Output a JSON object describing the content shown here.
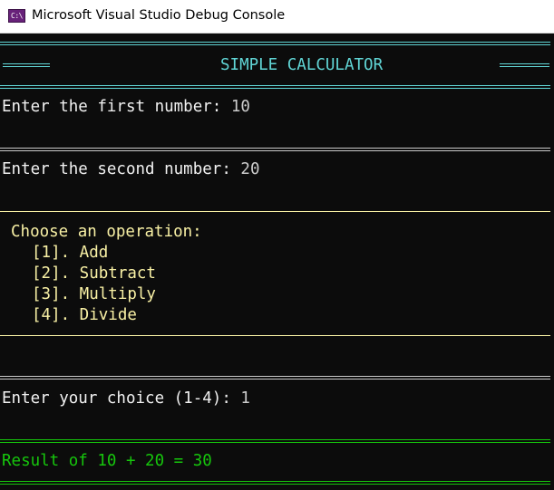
{
  "window": {
    "title": "Microsoft Visual Studio Debug Console",
    "icon": "console-app-icon",
    "icon_glyph": "C:\\"
  },
  "colors": {
    "background": "#0c0c0c",
    "cyan": "#61d6d6",
    "white": "#cccccc",
    "yellow": "#f9f1a5",
    "green": "#16c60c"
  },
  "console": {
    "header_title": "SIMPLE CALCULATOR",
    "first_prompt": "Enter the first number: ",
    "first_value": "10",
    "second_prompt": "Enter the second number: ",
    "second_value": "20",
    "menu": {
      "heading": "Choose an operation:",
      "options": [
        "[1]. Add",
        "[2]. Subtract",
        "[3]. Multiply",
        "[4]. Divide"
      ]
    },
    "choice_prompt": "Enter your choice (1-4): ",
    "choice_value": "1",
    "result": "Result of 10 + 20 = 30"
  }
}
